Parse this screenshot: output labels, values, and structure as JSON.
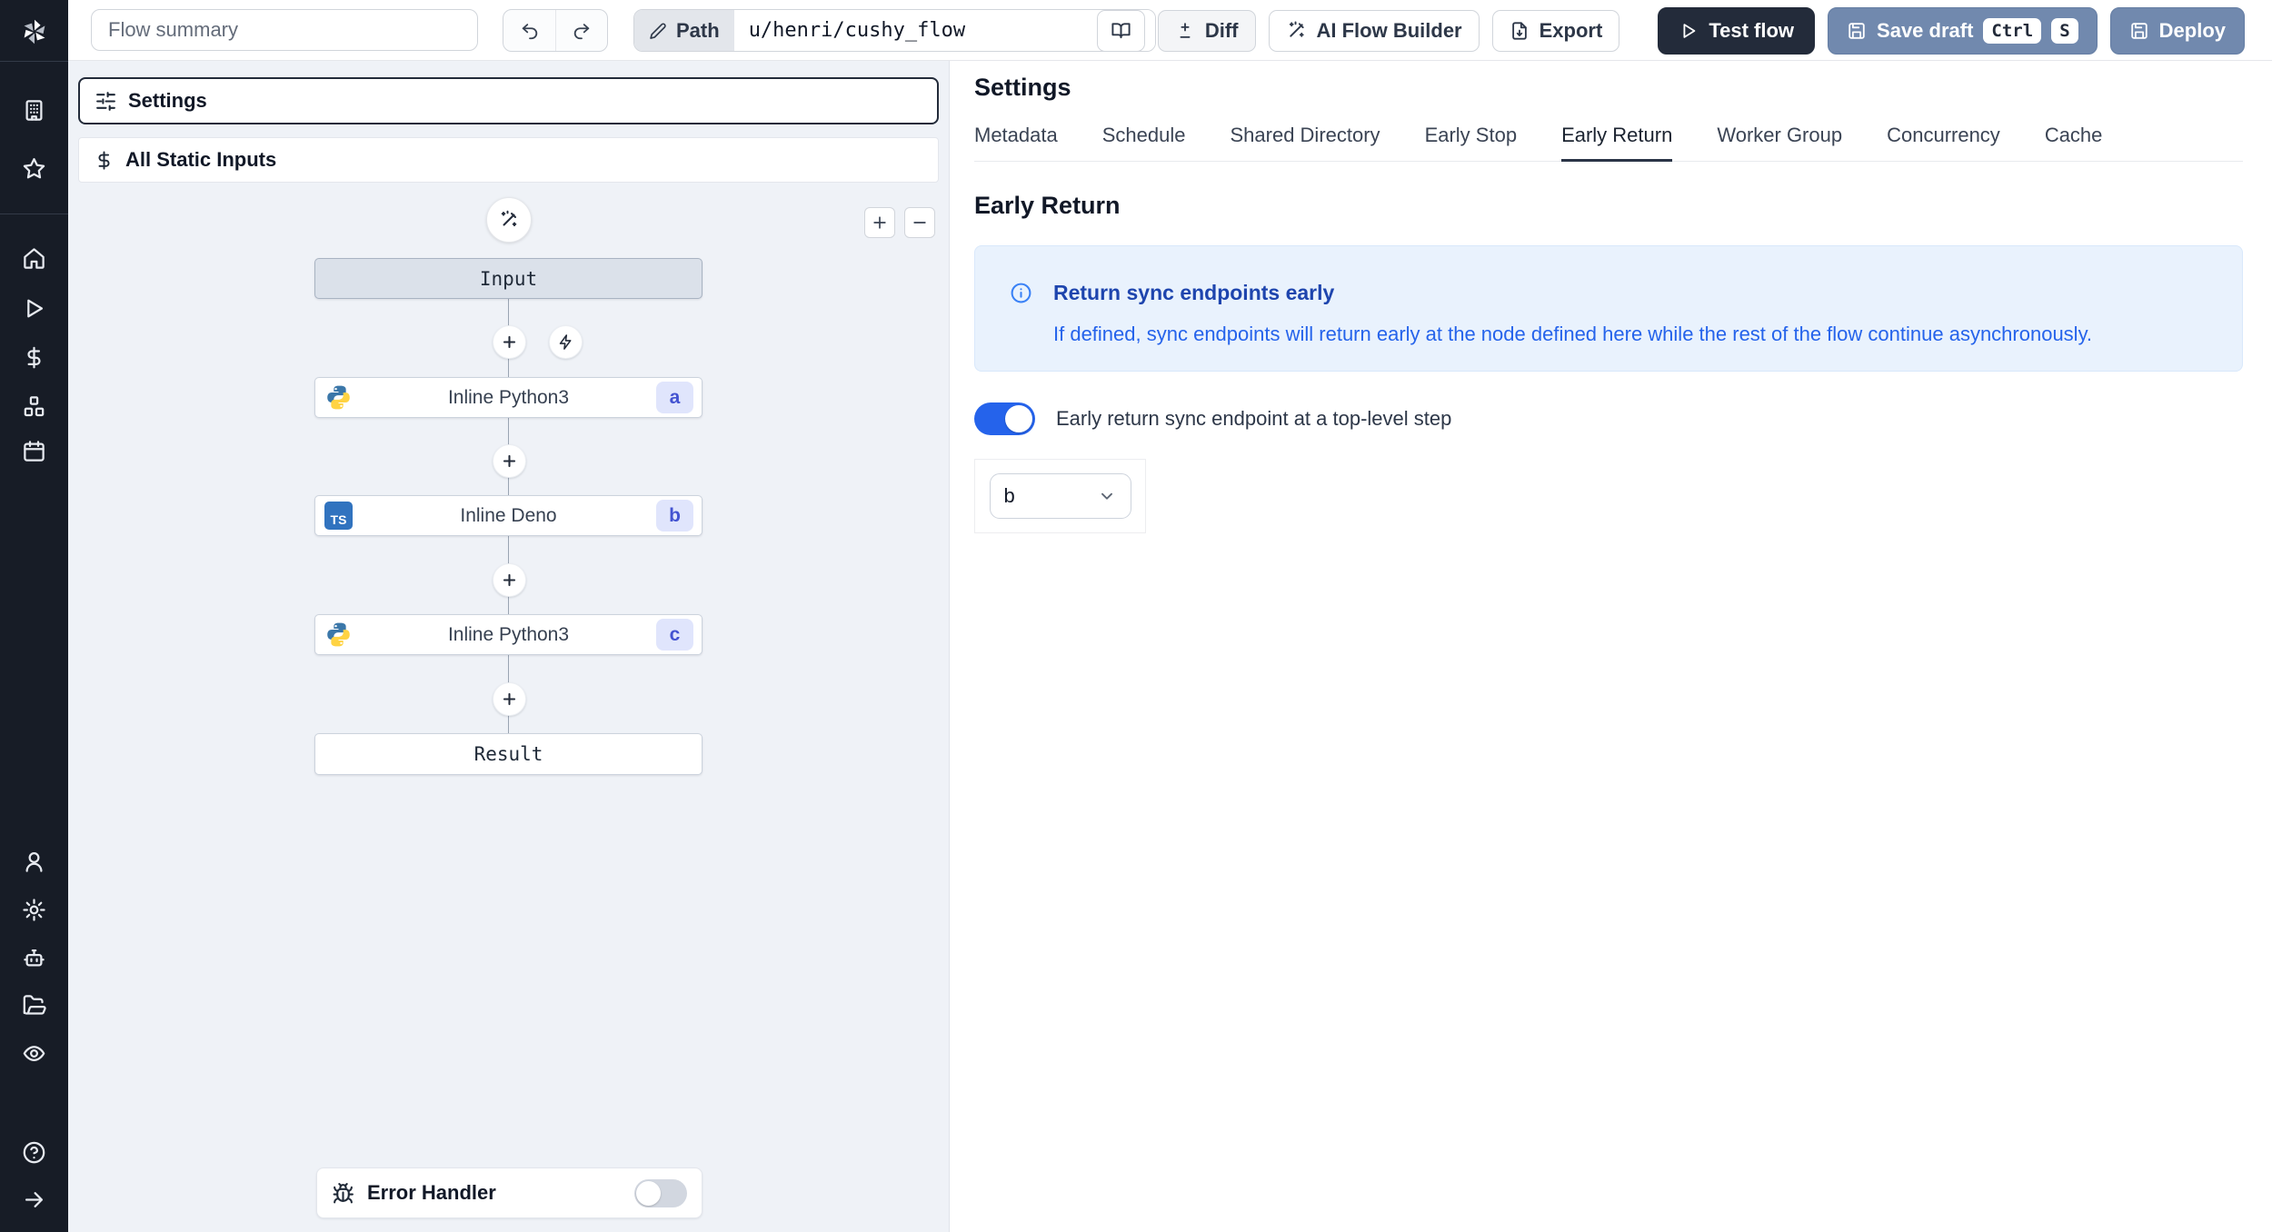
{
  "topbar": {
    "summary_placeholder": "Flow summary",
    "path_label": "Path",
    "path_value": "u/henri/cushy_flow",
    "diff_label": "Diff",
    "ai_builder_label": "AI Flow Builder",
    "export_label": "Export",
    "test_flow_label": "Test flow",
    "save_draft_label": "Save draft",
    "save_shortcut": [
      "Ctrl",
      "S"
    ],
    "deploy_label": "Deploy"
  },
  "flow_panel": {
    "settings_label": "Settings",
    "static_inputs_label": "All Static Inputs",
    "nodes": [
      {
        "id": "input",
        "label": "Input"
      },
      {
        "id": "a",
        "label": "Inline Python3",
        "badge": "a",
        "lang": "python"
      },
      {
        "id": "b",
        "label": "Inline Deno",
        "badge": "b",
        "lang": "typescript"
      },
      {
        "id": "c",
        "label": "Inline Python3",
        "badge": "c",
        "lang": "python"
      },
      {
        "id": "result",
        "label": "Result"
      }
    ],
    "ts_icon_label": "TS",
    "error_handler_label": "Error Handler",
    "error_handler_enabled": false
  },
  "settings_panel": {
    "title": "Settings",
    "tabs": [
      "Metadata",
      "Schedule",
      "Shared Directory",
      "Early Stop",
      "Early Return",
      "Worker Group",
      "Concurrency",
      "Cache"
    ],
    "active_tab": "Early Return",
    "section_title": "Early Return",
    "info_title": "Return sync endpoints early",
    "info_body": "If defined, sync endpoints will return early at the node defined here while the rest of the flow continue asynchronously.",
    "toggle_label": "Early return sync endpoint at a top-level step",
    "toggle_enabled": true,
    "select_value": "b"
  },
  "colors": {
    "accent_blue": "#2563eb",
    "primary_button": "#7189ae",
    "dark_button": "#232b3a",
    "badge_bg": "#e0e5fc",
    "badge_text": "#4353d1",
    "info_bg": "#e9f2fd",
    "sidebar_bg": "#171c26",
    "panel_bg": "#eff2f7"
  }
}
